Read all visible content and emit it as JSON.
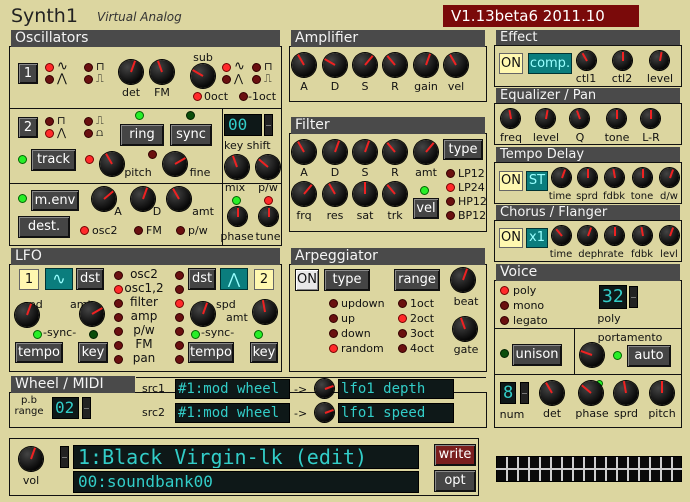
{
  "app": {
    "title": "Synth1",
    "subtitle": "Virtual Analog",
    "version": "V1.13beta6 2011.10"
  },
  "osc": {
    "header": "Oscillators",
    "osc1_num": "1",
    "osc2_num": "2",
    "det": "det",
    "fm": "FM",
    "sub": "sub",
    "sub_0oct": "0oct",
    "sub_m1oct": "-1oct",
    "ring": "ring",
    "sync": "sync",
    "key_shift_value": "00",
    "key_shift": "key shift",
    "track": "track",
    "pitch": "pitch",
    "fine": "fine",
    "mix": "mix",
    "pw": "p/w",
    "menv": "m.env",
    "dest": "dest.",
    "a": "A",
    "d": "D",
    "amt": "amt",
    "osc2": "osc2",
    "fm2": "FM",
    "pw2": "p/w",
    "phase": "phase",
    "tune": "tune"
  },
  "amp": {
    "header": "Amplifier",
    "labels": [
      "A",
      "D",
      "S",
      "R",
      "gain",
      "vel"
    ]
  },
  "filter": {
    "header": "Filter",
    "labels1": [
      "A",
      "D",
      "S",
      "R",
      "amt"
    ],
    "type": "type",
    "labels2": [
      "frq",
      "res",
      "sat",
      "trk"
    ],
    "vel": "vel",
    "types": [
      "LP12",
      "LP24",
      "HP12",
      "BP12"
    ]
  },
  "effect": {
    "header": "Effect",
    "on": "ON",
    "mode": "comp.",
    "labels": [
      "ctl1",
      "ctl2",
      "level"
    ]
  },
  "eq": {
    "header": "Equalizer / Pan",
    "labels": [
      "freq",
      "level",
      "Q",
      "tone",
      "L-R"
    ]
  },
  "delay": {
    "header": "Tempo Delay",
    "on": "ON",
    "mode": "ST",
    "labels": [
      "time",
      "sprd",
      "fdbk",
      "tone",
      "d/w"
    ]
  },
  "chorus": {
    "header": "Chorus / Flanger",
    "on": "ON",
    "mode": "x1",
    "labels": [
      "time",
      "dephrate",
      "fdbk",
      "levl"
    ]
  },
  "lfo": {
    "header": "LFO",
    "l1": "1",
    "l2": "2",
    "dst": "dst",
    "spd": "spd",
    "amt": "amt",
    "sync": "-sync-",
    "tempo": "tempo",
    "key": "key",
    "dests": [
      "osc2",
      "osc1,2",
      "filter",
      "amp",
      "p/w",
      "FM",
      "pan"
    ]
  },
  "arp": {
    "header": "Arpeggiator",
    "on": "ON",
    "type": "type",
    "range": "range",
    "beat": "beat",
    "gate": "gate",
    "types": [
      "updown",
      "up",
      "down",
      "random"
    ],
    "ranges": [
      "1oct",
      "2oct",
      "3oct",
      "4oct"
    ]
  },
  "voice": {
    "header": "Voice",
    "modes": [
      "poly",
      "mono",
      "legato"
    ],
    "poly_value": "32",
    "poly": "poly",
    "portamento": "portamento",
    "unison": "unison",
    "auto": "auto",
    "num_value": "8",
    "num": "num",
    "det": "det",
    "phase": "phase",
    "sprd": "sprd",
    "pitch": "pitch"
  },
  "wheel": {
    "header": "Wheel / MIDI",
    "pb_label": "p.b\nrange",
    "pb_value": "02",
    "src1": "src1",
    "src2": "src2",
    "src1_val": "#1:mod wheel",
    "src2_val": "#1:mod wheel",
    "arrow": "->",
    "dst1": "lfo1 depth",
    "dst2": "lfo1 speed"
  },
  "footer": {
    "vol": "vol",
    "patch": "1:Black Virgin-lk (edit)",
    "bank": "00:soundbank00",
    "write": "write",
    "opt": "opt"
  },
  "colors": {
    "panel": "#dcd6a0",
    "header": "#4a4a4a",
    "lcd_text": "#32cdc8",
    "led_red": "#ff2a2a",
    "led_green": "#28ee28"
  }
}
